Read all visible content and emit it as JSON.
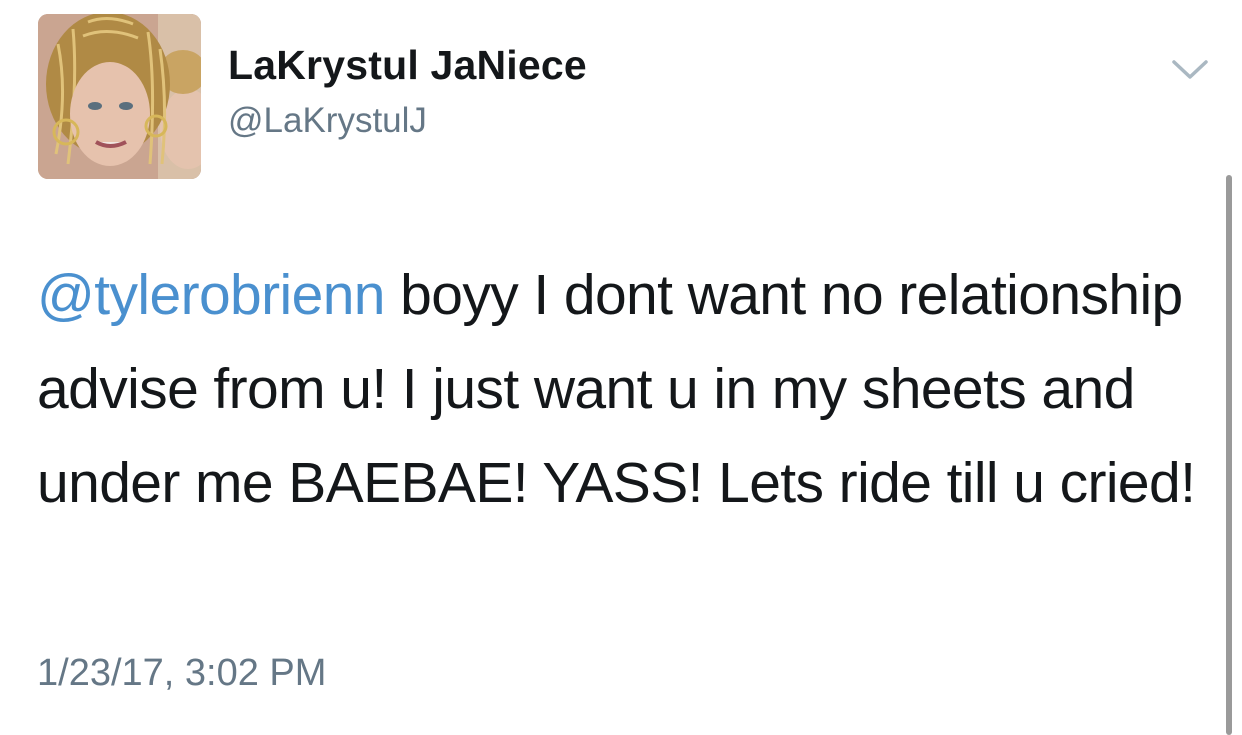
{
  "tweet": {
    "author": {
      "display_name": "LaKrystul JaNiece",
      "handle": "@LaKrystulJ",
      "avatar_icon": "profile-photo"
    },
    "menu_icon": "chevron-down-icon",
    "text": {
      "mention": "@tylerobrienn",
      "body": " boyy I dont want no relationship advise from u! I just want u in my sheets and under me BAEBAE! YASS! Lets ride till u cried!"
    },
    "timestamp": "1/23/17, 3:02 PM"
  },
  "colors": {
    "text": "#14171a",
    "secondary": "#657786",
    "mention": "#4a90cf",
    "background": "#ffffff"
  }
}
